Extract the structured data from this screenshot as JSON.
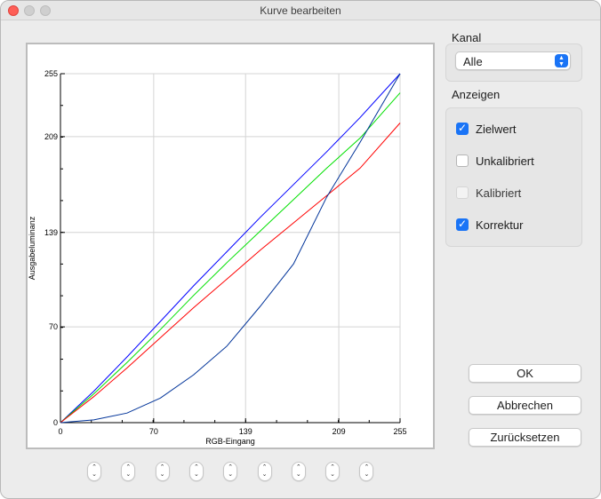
{
  "window": {
    "title": "Kurve bearbeiten"
  },
  "channel": {
    "label": "Kanal",
    "selected": "Alle"
  },
  "display": {
    "label": "Anzeigen",
    "options": [
      {
        "label": "Zielwert",
        "checked": true,
        "enabled": true
      },
      {
        "label": "Unkalibriert",
        "checked": false,
        "enabled": true
      },
      {
        "label": "Kalibriert",
        "checked": false,
        "enabled": false
      },
      {
        "label": "Korrektur",
        "checked": true,
        "enabled": true
      }
    ]
  },
  "buttons": {
    "ok": "OK",
    "cancel": "Abbrechen",
    "reset": "Zurücksetzen"
  },
  "stepper_count": 9,
  "chart_data": {
    "type": "line",
    "xlabel": "RGB-Eingang",
    "ylabel": "Ausgabeluminanz",
    "xlim": [
      0,
      255
    ],
    "ylim": [
      0,
      255
    ],
    "xticks": [
      0,
      70,
      139,
      209,
      255
    ],
    "yticks": [
      0,
      70,
      139,
      209,
      255
    ],
    "grid": true,
    "series": [
      {
        "color": "#0000ff",
        "x": [
          0,
          25,
          50,
          75,
          100,
          125,
          150,
          175,
          200,
          225,
          255
        ],
        "y": [
          0,
          23,
          48,
          74,
          100,
          125,
          150,
          174,
          198,
          223,
          255
        ]
      },
      {
        "color": "#00e000",
        "x": [
          0,
          25,
          50,
          75,
          100,
          125,
          150,
          175,
          200,
          225,
          255
        ],
        "y": [
          0,
          21,
          44,
          68,
          93,
          117,
          140,
          163,
          186,
          208,
          241
        ]
      },
      {
        "color": "#ff0000",
        "x": [
          0,
          25,
          50,
          75,
          100,
          125,
          150,
          175,
          200,
          225,
          255
        ],
        "y": [
          0,
          19,
          40,
          62,
          84,
          105,
          126,
          146,
          166,
          186,
          219
        ]
      },
      {
        "color": "#003399",
        "x": [
          0,
          25,
          50,
          75,
          100,
          125,
          150,
          175,
          200,
          225,
          255
        ],
        "y": [
          0,
          2,
          7,
          18,
          35,
          56,
          85,
          116,
          165,
          205,
          255
        ]
      }
    ]
  }
}
